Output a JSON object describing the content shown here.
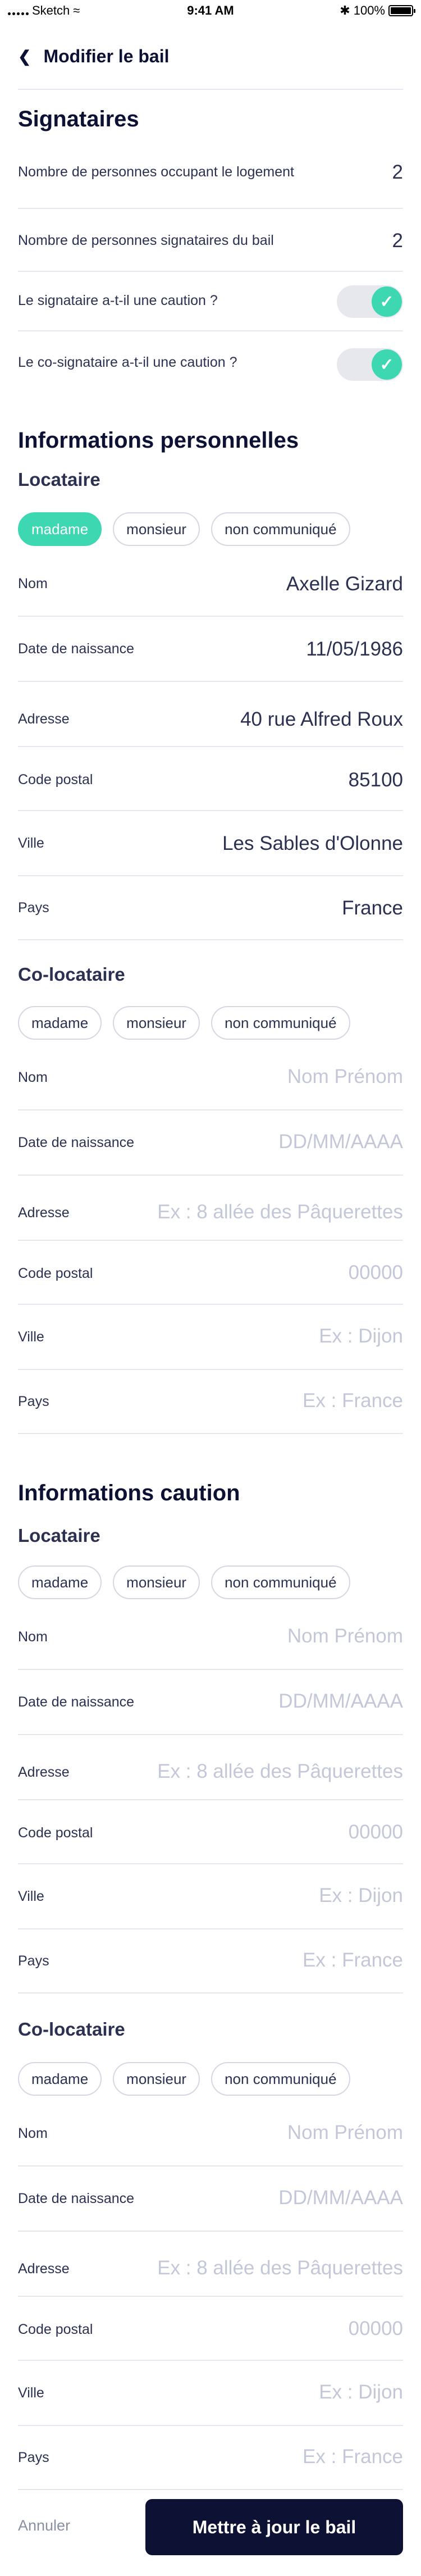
{
  "status_bar": {
    "carrier": "Sketch",
    "time": "9:41 AM",
    "battery": "100%"
  },
  "header": {
    "title": "Modifier le bail"
  },
  "signataires": {
    "title": "Signataires",
    "rows": [
      {
        "label": "Nombre de personnes occupant le logement",
        "value": "2"
      },
      {
        "label": "Nombre de personnes signataires du bail",
        "value": "2"
      }
    ],
    "toggles": [
      {
        "label": "Le signataire a-t-il une caution ?",
        "on": true
      },
      {
        "label": "Le co-signataire a-t-il une caution ?",
        "on": true
      }
    ]
  },
  "civilite_options": [
    "madame",
    "monsieur",
    "non communiqué"
  ],
  "infos_perso": {
    "title": "Informations personnelles",
    "locataire": {
      "title": "Locataire",
      "selected": "madame",
      "fields": [
        {
          "label": "Nom",
          "value": "Axelle Gizard"
        },
        {
          "label": "Date de naissance",
          "value": "11/05/1986"
        },
        {
          "label": "Adresse",
          "value": "40 rue Alfred Roux"
        },
        {
          "label": "Code postal",
          "value": "85100"
        },
        {
          "label": "Ville",
          "value": "Les Sables d'Olonne"
        },
        {
          "label": "Pays",
          "value": "France"
        }
      ]
    },
    "colocataire": {
      "title": "Co-locataire",
      "fields": [
        {
          "label": "Nom",
          "placeholder": "Nom Prénom"
        },
        {
          "label": "Date de naissance",
          "placeholder": "DD/MM/AAAA"
        },
        {
          "label": "Adresse",
          "placeholder": "Ex : 8 allée des Pâquerettes"
        },
        {
          "label": "Code postal",
          "placeholder": "00000"
        },
        {
          "label": "Ville",
          "placeholder": "Ex : Dijon"
        },
        {
          "label": "Pays",
          "placeholder": "Ex : France"
        }
      ]
    }
  },
  "infos_caution": {
    "title": "Informations caution",
    "locataire": {
      "title": "Locataire",
      "fields": [
        {
          "label": "Nom",
          "placeholder": "Nom Prénom"
        },
        {
          "label": "Date de naissance",
          "placeholder": "DD/MM/AAAA"
        },
        {
          "label": "Adresse",
          "placeholder": "Ex : 8 allée des Pâquerettes"
        },
        {
          "label": "Code postal",
          "placeholder": "00000"
        },
        {
          "label": "Ville",
          "placeholder": "Ex : Dijon"
        },
        {
          "label": "Pays",
          "placeholder": "Ex : France"
        }
      ]
    },
    "colocataire": {
      "title": "Co-locataire",
      "fields": [
        {
          "label": "Nom",
          "placeholder": "Nom Prénom"
        },
        {
          "label": "Date de naissance",
          "placeholder": "DD/MM/AAAA"
        },
        {
          "label": "Adresse",
          "placeholder": "Ex : 8 allée des Pâquerettes"
        },
        {
          "label": "Code postal",
          "placeholder": "00000"
        },
        {
          "label": "Ville",
          "placeholder": "Ex : Dijon"
        },
        {
          "label": "Pays",
          "placeholder": "Ex : France"
        }
      ]
    }
  },
  "footer": {
    "cancel_label": "Annuler",
    "submit_label": "Mettre à jour le bail"
  },
  "colors": {
    "accent": "#3dd8b1",
    "primary": "#0d1133",
    "divider": "#e6e8ef",
    "placeholder": "#c3c7d8"
  }
}
